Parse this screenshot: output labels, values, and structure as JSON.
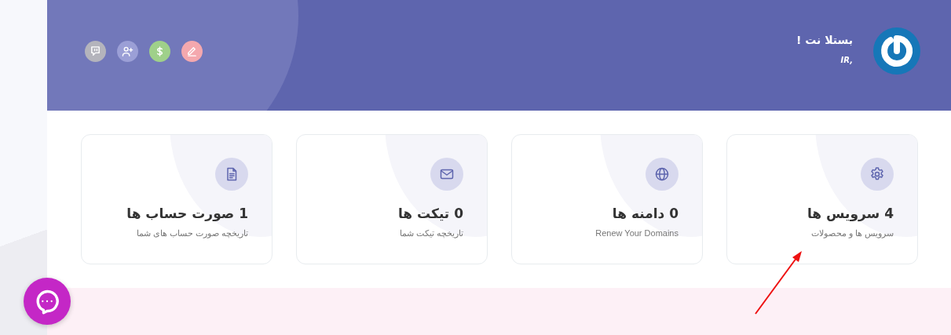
{
  "header": {
    "name": "بستلا نت !",
    "subtitle": "IR,",
    "actions": [
      {
        "kind": "pencil",
        "color": "#f4a8ae"
      },
      {
        "kind": "dollar",
        "color": "#9fd08a"
      },
      {
        "kind": "user-plus",
        "color": "#9b9fd6"
      },
      {
        "kind": "chat",
        "color": "#b4b4bc"
      }
    ]
  },
  "cards": [
    {
      "kind": "gear",
      "title": "4 سرویس ها",
      "subtitle": "سرویس ها و محصولات"
    },
    {
      "kind": "globe",
      "title": "0 دامنه ها",
      "subtitle": "Renew Your Domains"
    },
    {
      "kind": "mail",
      "title": "0 تیکت ها",
      "subtitle": "تاریخچه تیکت شما"
    },
    {
      "kind": "document",
      "title": "1 صورت حساب ها",
      "subtitle": "تاریخچه صورت حساب های شما"
    }
  ]
}
